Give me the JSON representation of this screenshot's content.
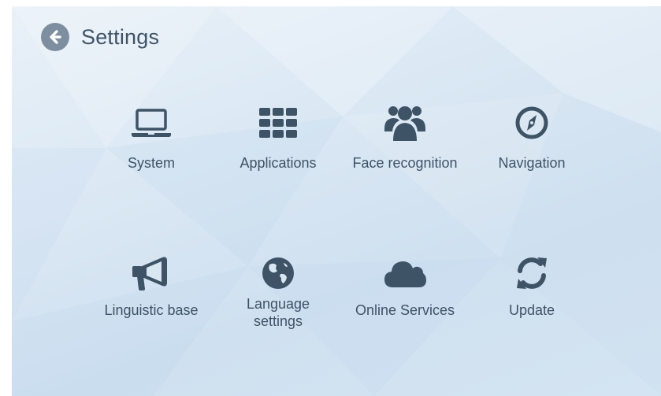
{
  "header": {
    "title": "Settings",
    "back_icon": "arrow-left-circle-icon"
  },
  "tiles": [
    {
      "label": "System",
      "icon": "laptop-icon"
    },
    {
      "label": "Applications",
      "icon": "grid-icon"
    },
    {
      "label": "Face recognition",
      "icon": "users-icon"
    },
    {
      "label": "Navigation",
      "icon": "compass-icon"
    },
    {
      "label": "Linguistic base",
      "icon": "megaphone-icon"
    },
    {
      "label": "Language settings",
      "icon": "globe-icon"
    },
    {
      "label": "Online Services",
      "icon": "cloud-icon"
    },
    {
      "label": "Update",
      "icon": "refresh-icon"
    }
  ],
  "colors": {
    "text": "#3e5366",
    "icon": "#3e5366",
    "back_button": "#7d8ea0",
    "background": "#d9e7f3"
  }
}
